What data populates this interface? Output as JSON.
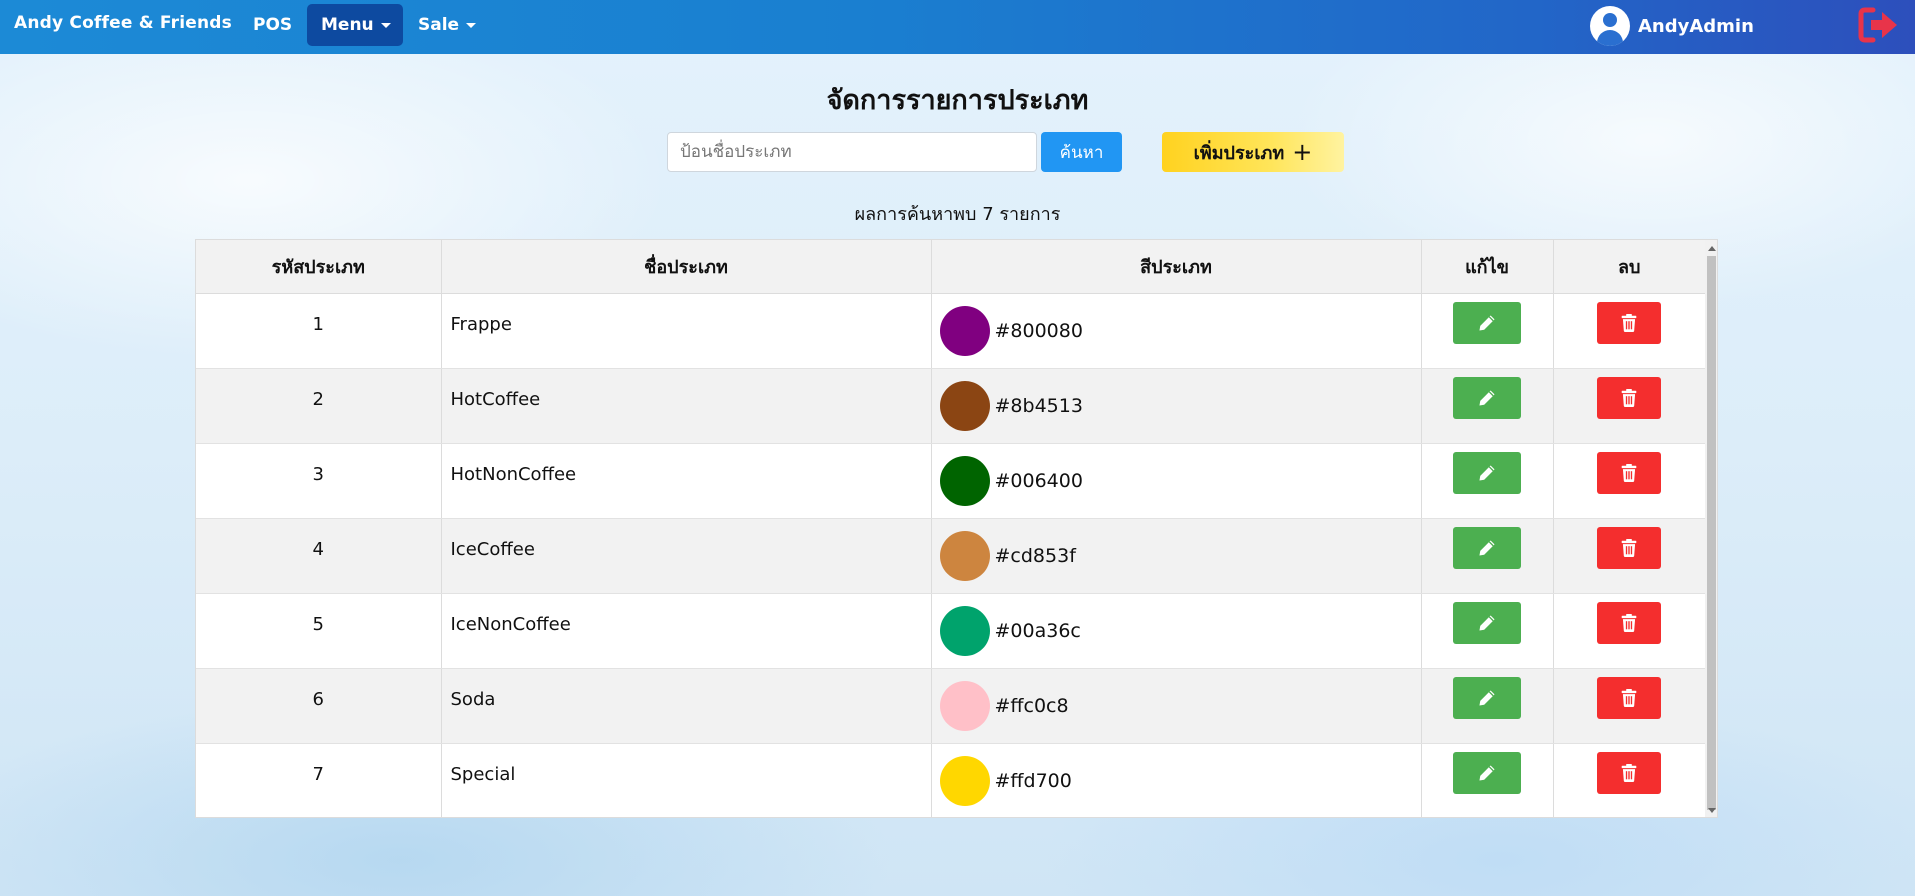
{
  "navbar": {
    "brand": "Andy Coffee & Friends",
    "links": [
      {
        "label": "POS"
      },
      {
        "label": "Menu"
      },
      {
        "label": "Sale"
      }
    ],
    "user_name": "AndyAdmin",
    "logout_icon": "logout-icon",
    "colors": {
      "bar_start": "#1c8ad6",
      "bar_end": "#2d4fbc",
      "active_link": "#0d4aa0",
      "logout": "#e8344a"
    }
  },
  "page": {
    "title": "จัดการรายการประเภท",
    "search": {
      "placeholder": "ป้อนชื่อประเภท",
      "value": ""
    },
    "search_button": "ค้นหา",
    "add_button": "เพิ่มประเภท",
    "add_icon": "plus-icon",
    "result_text": "ผลการค้นหาพบ 7 รายการ"
  },
  "table": {
    "headers": [
      "รหัสประเภท",
      "ชื่อประเภท",
      "สีประเภท",
      "แก้ไข",
      "ลบ"
    ],
    "rows": [
      {
        "id": "1",
        "name": "Frappe",
        "color": "#800080"
      },
      {
        "id": "2",
        "name": "HotCoffee",
        "color": "#8b4513"
      },
      {
        "id": "3",
        "name": "HotNonCoffee",
        "color": "#006400"
      },
      {
        "id": "4",
        "name": "IceCoffee",
        "color": "#cd853f"
      },
      {
        "id": "5",
        "name": "IceNonCoffee",
        "color": "#00a36c"
      },
      {
        "id": "6",
        "name": "Soda",
        "color": "#ffc0c8"
      },
      {
        "id": "7",
        "name": "Special",
        "color": "#ffd700"
      }
    ],
    "edit_icon": "pencil-icon",
    "delete_icon": "trash-icon",
    "colors": {
      "edit": "#4caf50",
      "delete": "#f42e2e",
      "search": "#2196f3",
      "add": "#ffd21f"
    }
  }
}
